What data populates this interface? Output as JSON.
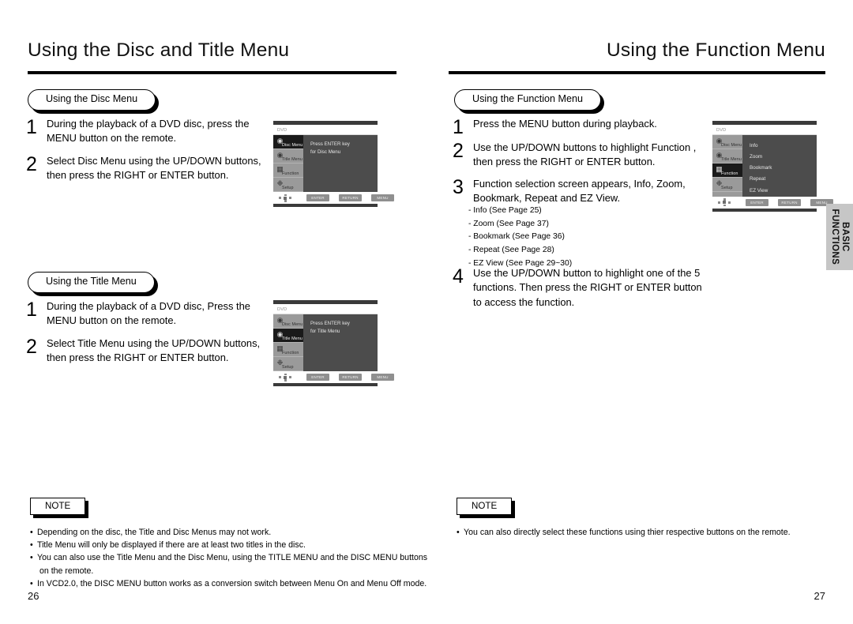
{
  "left_page": {
    "heading": "Using the Disc and Title Menu",
    "folio": "26",
    "section_disc": {
      "badge": "Using the Disc Menu",
      "steps": [
        {
          "num": "1",
          "lines": [
            "During the playback of a DVD disc, press the",
            "MENU button on the remote."
          ]
        },
        {
          "num": "2",
          "lines": [
            "Select Disc Menu  using the UP/DOWN buttons,",
            "then press the RIGHT or ENTER button."
          ]
        }
      ],
      "screen": {
        "label": "DVD",
        "sidebar": [
          {
            "label": "Disc Menu",
            "icon": "disc-menu-icon",
            "selected": true
          },
          {
            "label": "Title Menu",
            "icon": "title-menu-icon",
            "selected": false
          },
          {
            "label": "Function",
            "icon": "function-icon",
            "selected": false
          },
          {
            "label": "Setup",
            "icon": "setup-gear-icon",
            "selected": false
          }
        ],
        "content_lines": [
          "Press ENTER key",
          "for Disc Menu"
        ],
        "keys": [
          "ENTER",
          "RETURN",
          "MENU"
        ]
      }
    },
    "section_title": {
      "badge": "Using the Title Menu",
      "steps": [
        {
          "num": "1",
          "lines": [
            "During the playback of a DVD disc, Press the",
            "MENU button on the remote."
          ]
        },
        {
          "num": "2",
          "lines": [
            "Select Title Menu  using the UP/DOWN buttons,",
            "then press the RIGHT or ENTER button."
          ]
        }
      ],
      "screen": {
        "label": "DVD",
        "sidebar": [
          {
            "label": "Disc Menu",
            "icon": "disc-menu-icon",
            "selected": false
          },
          {
            "label": "Title Menu",
            "icon": "title-menu-icon",
            "selected": true
          },
          {
            "label": "Function",
            "icon": "function-icon",
            "selected": false
          },
          {
            "label": "Setup",
            "icon": "setup-gear-icon",
            "selected": false
          }
        ],
        "content_lines": [
          "Press ENTER key",
          "for Title Menu"
        ],
        "keys": [
          "ENTER",
          "RETURN",
          "MENU"
        ]
      }
    },
    "note": {
      "title": "NOTE",
      "bullets": [
        {
          "text": "Depending on the disc, the Title and Disc Menus may not work.",
          "cont": ""
        },
        {
          "text": "Title Menu will only be displayed if there are at least two titles in the disc.",
          "cont": ""
        },
        {
          "text": "You can also use the Title Menu and the Disc Menu, using the TITLE MENU and the DISC MENU buttons",
          "cont": "on the remote."
        },
        {
          "text": "In VCD2.0, the DISC MENU button works as a conversion switch between Menu On and Menu Off mode.",
          "cont": ""
        }
      ]
    }
  },
  "right_page": {
    "heading": "Using the Function Menu",
    "folio": "27",
    "section_function": {
      "badge": "Using the Function Menu",
      "steps": [
        {
          "num": "1",
          "lines": [
            "Press the MENU button during playback."
          ]
        },
        {
          "num": "2",
          "lines": [
            "Use the UP/DOWN buttons to highlight Function ,",
            "then press the RIGHT or ENTER button."
          ]
        },
        {
          "num": "3",
          "lines": [
            "Function selection screen appears, Info, Zoom,",
            "Bookmark, Repeat and EZ View."
          ]
        },
        {
          "num": "4",
          "lines": [
            "Use the UP/DOWN button to highlight one of the 5",
            "functions. Then press the RIGHT or ENTER button",
            "to access the function."
          ]
        }
      ],
      "sublist": [
        "-  Info (See Page 25)",
        "-  Zoom (See Page 37)",
        "-  Bookmark (See Page 36)",
        "-  Repeat (See Page 28)",
        "-  EZ View (See Page 29~30)"
      ],
      "screen": {
        "label": "DVD",
        "sidebar": [
          {
            "label": "Disc Menu",
            "icon": "disc-menu-icon",
            "selected": false
          },
          {
            "label": "Title Menu",
            "icon": "title-menu-icon",
            "selected": false
          },
          {
            "label": "Function",
            "icon": "function-icon",
            "selected": true
          },
          {
            "label": "Setup",
            "icon": "setup-gear-icon",
            "selected": false
          }
        ],
        "content_lines": [
          "Info",
          "Zoom",
          "Bookmark",
          "Repeat",
          "EZ View"
        ],
        "keys": [
          "ENTER",
          "RETURN",
          "MENU"
        ]
      }
    },
    "side_tab": {
      "line1": "BASIC",
      "line2": "FUNCTIONS"
    },
    "note": {
      "title": "NOTE",
      "bullets": [
        {
          "text": "You can also directly select these functions using thier respective buttons on the remote.",
          "cont": ""
        }
      ]
    }
  }
}
